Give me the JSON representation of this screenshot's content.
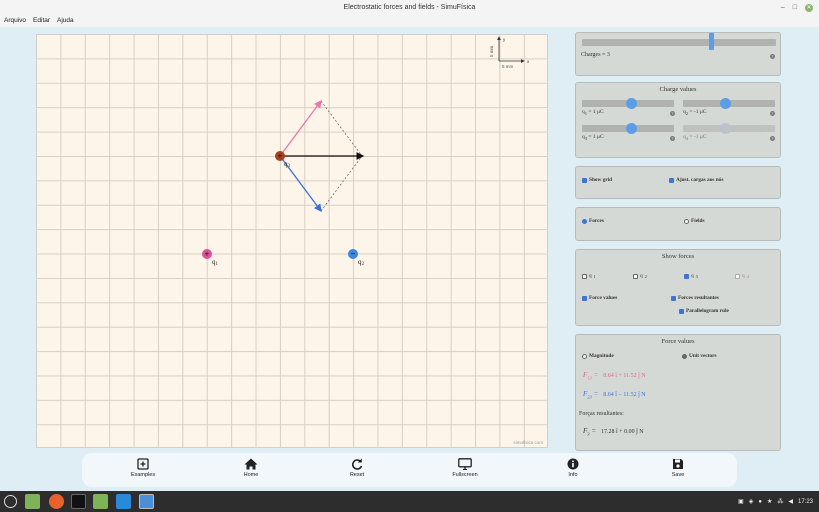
{
  "window": {
    "title": "Electrostatic forces and fields - SimuFísica",
    "minimize": "–",
    "maximize": "□",
    "close": "✕"
  },
  "menu": [
    "Arquivo",
    "Editar",
    "Ajuda"
  ],
  "canvas": {
    "scale_x_label": "5 mm",
    "scale_y_label": "5 mm",
    "axis_x": "x",
    "axis_y": "y",
    "credit": "simufisica.com",
    "charges": [
      {
        "label": "q",
        "sub": "1",
        "sign": "+",
        "color": "#e0509a"
      },
      {
        "label": "q",
        "sub": "2",
        "sign": "−",
        "color": "#3a86e0"
      },
      {
        "label": "q",
        "sub": "3",
        "sign": "+",
        "color": "#a84020"
      }
    ],
    "vector_colors": {
      "f13": "#e879a8",
      "f23": "#3b6fd8",
      "resultant": "#111111"
    }
  },
  "charges_panel": {
    "label": "Charges = 3",
    "value": 3,
    "max": 4
  },
  "charge_values": {
    "title": "Charge values",
    "items": [
      {
        "name": "q",
        "sub": "1",
        "text": " = 1 μC",
        "dim": false
      },
      {
        "name": "q",
        "sub": "2",
        "text": " = -1 μC",
        "dim": false
      },
      {
        "name": "q",
        "sub": "3",
        "text": " = 1 μC",
        "dim": false
      },
      {
        "name": "q",
        "sub": "4",
        "text": " = -1 μC",
        "dim": true
      }
    ]
  },
  "options": {
    "show_grid": "Show grid",
    "adjust": "Ajust. cargas aos nós"
  },
  "mode": {
    "forces": "Forces",
    "fields": "Fields"
  },
  "show_forces": {
    "title": "Show forces",
    "q": [
      {
        "name": "q",
        "sub": "1",
        "checked": false
      },
      {
        "name": "q",
        "sub": "2",
        "checked": false
      },
      {
        "name": "q",
        "sub": "3",
        "checked": true
      },
      {
        "name": "q",
        "sub": "4",
        "checked": false
      }
    ],
    "force_values": "Force values",
    "forces_resultantes": "Forces resultantes",
    "parallelogram": "Parallelogram rule"
  },
  "force_values": {
    "title": "Force values",
    "magnitude": "Magnitude",
    "unit_vectors": "Unit vectors",
    "f13": {
      "sym": "F",
      "sub": "13",
      "expr": "8.64 î + 11.52 ĵ  N",
      "color": "#e0609a"
    },
    "f23": {
      "sym": "F",
      "sub": "23",
      "expr": "8.64 î − 11.52 ĵ  N",
      "color": "#3b6fd8"
    },
    "resultantes_label": "Forças resultantes:",
    "f3": {
      "sym": "F",
      "sub": "3",
      "expr": "17.28 î + 0.00 ĵ  N",
      "color": "#333333"
    }
  },
  "toolbar": [
    {
      "label": "Examples",
      "icon": "plus-square-icon"
    },
    {
      "label": "Home",
      "icon": "home-icon"
    },
    {
      "label": "Reset",
      "icon": "refresh-icon"
    },
    {
      "label": "Fullscreen",
      "icon": "monitor-icon"
    },
    {
      "label": "Info",
      "icon": "info-icon"
    },
    {
      "label": "Save",
      "icon": "save-icon"
    }
  ],
  "taskbar": {
    "clock": "17:23"
  }
}
